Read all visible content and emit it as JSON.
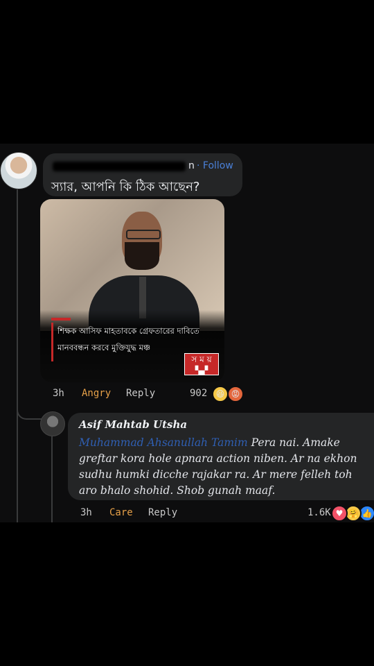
{
  "comment1": {
    "name_tail": "n",
    "follow": "· Follow",
    "text": "স্যার, আপনি কি ঠিক আছেন?"
  },
  "image": {
    "caption_line1": "শিক্ষক আসিফ মাহতাবকে গ্রেফতারের দাবিতে",
    "caption_line2": "মানববন্ধন করবে মুক্তিযুদ্ধ মঞ্চ",
    "logo_top": "স ম য়",
    "logo_bottom": "▚▞"
  },
  "comment1_meta": {
    "time": "3h",
    "reaction_label": "Angry",
    "reply": "Reply",
    "count": "902"
  },
  "comment2": {
    "author": "Asif Mahtab Utsha",
    "mention": "Muhammad Ahsanullah Tamim",
    "text": " Pera nai. Amake greftar kora hole apnara action niben. Ar na ekhon sudhu humki dicche rajakar ra. Ar mere felleh toh aro bhalo shohid. Shob gunah maaf."
  },
  "comment2_meta": {
    "time": "3h",
    "reaction_label": "Care",
    "reply": "Reply",
    "count": "1.6K"
  },
  "reactions": {
    "haha_icon": "😆",
    "angry_icon": "😡",
    "love_icon": "♥",
    "care_icon": "🤗",
    "like_icon": "👍"
  },
  "colors": {
    "angry": "#e6a048",
    "link": "#2f5fb3",
    "follow": "#4a80d8"
  }
}
